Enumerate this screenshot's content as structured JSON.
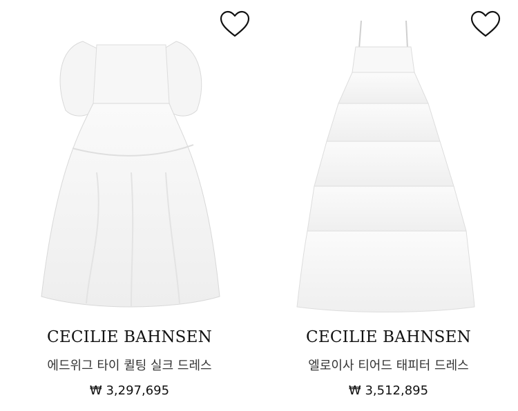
{
  "products": [
    {
      "brand": "CECILIE BAHNSEN",
      "name": "에드위그 타이 퀼팅 실크 드레스",
      "price": "₩ 3,297,695",
      "image_alt": "White quilted puff-sleeve tiered silk dress",
      "wishlist_icon": "heart-outline-icon"
    },
    {
      "brand": "CECILIE BAHNSEN",
      "name": "엘로이사 티어드 태피터 드레스",
      "price": "₩ 3,512,895",
      "image_alt": "White tiered taffeta maxi dress with spaghetti straps",
      "wishlist_icon": "heart-outline-icon"
    }
  ],
  "colors": {
    "text": "#111111",
    "subtext": "#333333",
    "background": "#ffffff"
  }
}
